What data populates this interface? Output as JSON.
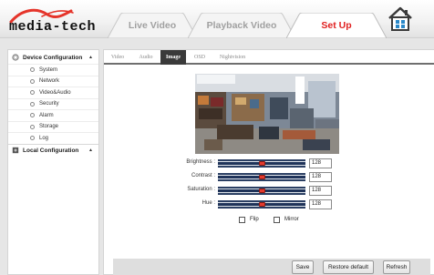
{
  "brand": {
    "logo_text": "media-tech"
  },
  "top_tabs": [
    {
      "label": "Live Video",
      "active": false
    },
    {
      "label": "Playback Video",
      "active": false
    },
    {
      "label": "Set Up",
      "active": true
    }
  ],
  "home_icon": "home-icon",
  "sidebar": {
    "groups": [
      {
        "label": "Device Configuration",
        "icon": "device-config-icon",
        "expanded": true,
        "items": [
          {
            "label": "System"
          },
          {
            "label": "Network"
          },
          {
            "label": "Video&Audio"
          },
          {
            "label": "Security"
          },
          {
            "label": "Alarm"
          },
          {
            "label": "Storage"
          },
          {
            "label": "Log"
          }
        ]
      },
      {
        "label": "Local Configuration",
        "icon": "local-config-icon",
        "expanded": true,
        "items": []
      }
    ]
  },
  "subtabs": [
    {
      "label": "Video",
      "active": false
    },
    {
      "label": "Audio",
      "active": false
    },
    {
      "label": "Image",
      "active": true
    },
    {
      "label": "OSD",
      "active": false
    },
    {
      "label": "Nightvision",
      "active": false
    }
  ],
  "image_settings": [
    {
      "label": "Brightness :",
      "value": "128",
      "level": 0.5
    },
    {
      "label": "Contrast :",
      "value": "128",
      "level": 0.5
    },
    {
      "label": "Saturation :",
      "value": "128",
      "level": 0.5
    },
    {
      "label": "Hue :",
      "value": "128",
      "level": 0.5
    }
  ],
  "flip_label": "Flip",
  "mirror_label": "Mirror",
  "flip_checked": false,
  "mirror_checked": false,
  "buttons": {
    "save": "Save",
    "restore": "Restore default",
    "refresh": "Refresh"
  },
  "colors": {
    "accent_red": "#e02020",
    "subtab_active_bg": "#3a3a3a",
    "thumb_red": "#e33a2e",
    "track_blue": "#2b3f63"
  }
}
